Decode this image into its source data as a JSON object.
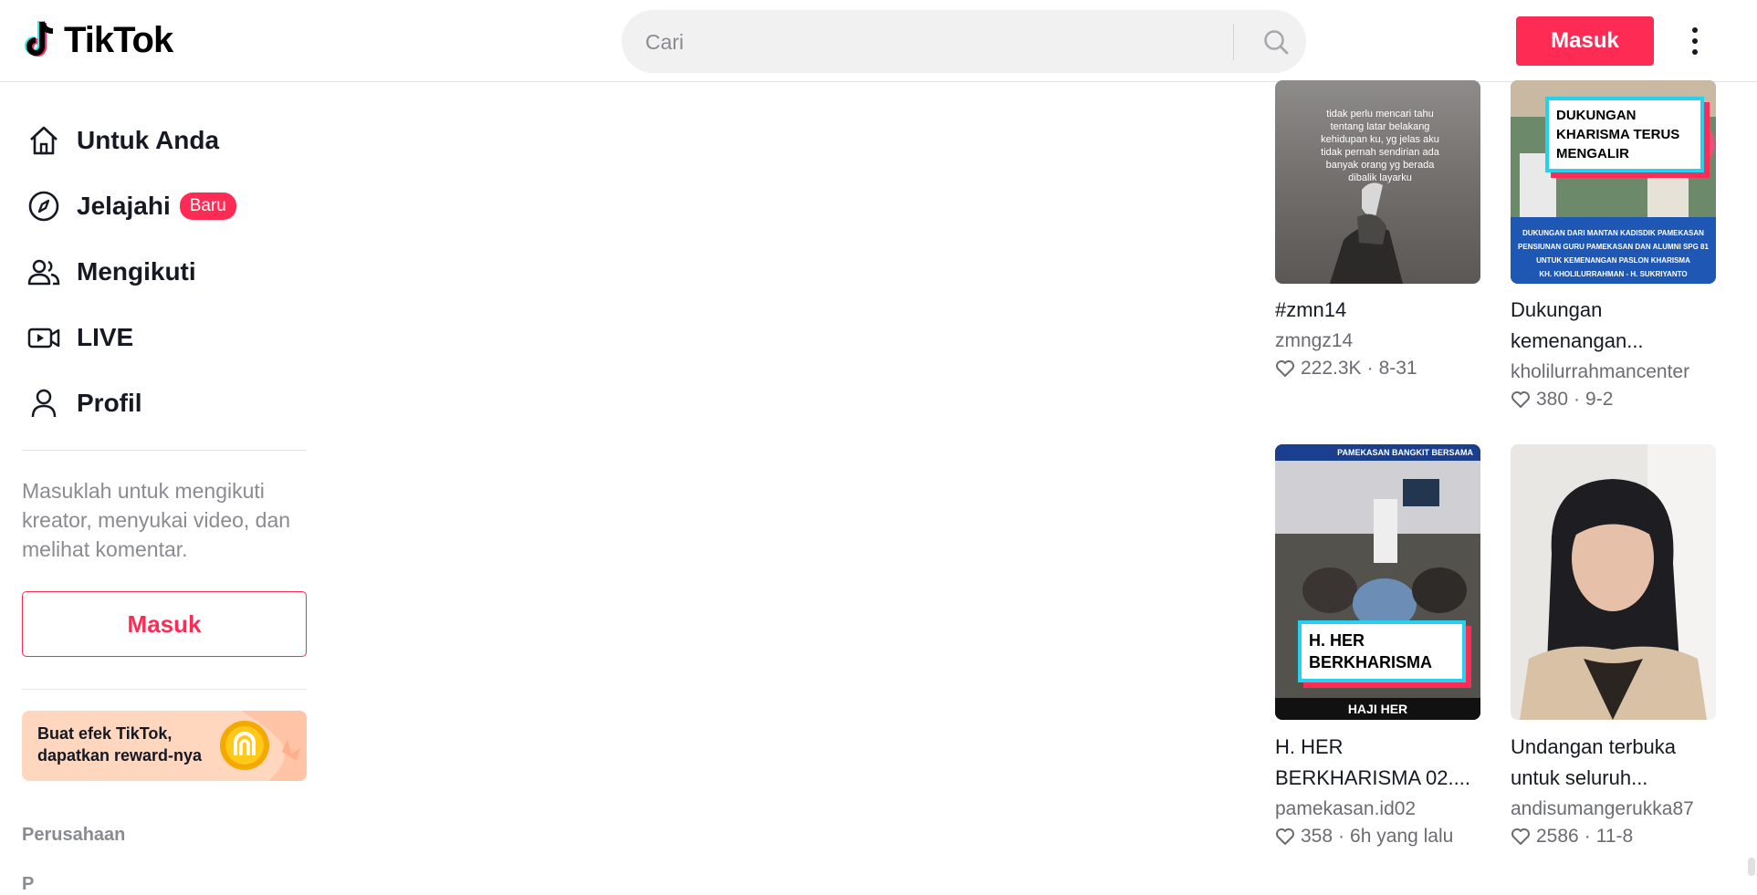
{
  "header": {
    "logo_text": "TikTok",
    "search_placeholder": "Cari",
    "login_label": "Masuk"
  },
  "sidebar": {
    "nav": [
      {
        "label": "Untuk Anda",
        "icon": "home-icon"
      },
      {
        "label": "Jelajahi",
        "icon": "compass-icon",
        "badge": "Baru"
      },
      {
        "label": "Mengikuti",
        "icon": "users-icon"
      },
      {
        "label": "LIVE",
        "icon": "live-icon"
      },
      {
        "label": "Profil",
        "icon": "profile-icon"
      }
    ],
    "login_hint": "Masuklah untuk mengikuti kreator, menyukai video, dan melihat komentar.",
    "login_label": "Masuk",
    "promo": {
      "line1": "Buat efek TikTok,",
      "line2": "dapatkan reward-nya"
    },
    "section_title": "Perusahaan",
    "cut_link": "P"
  },
  "videos": [
    {
      "title": "#zmn14",
      "author": "zmngz14",
      "likes": "222.3K",
      "date": "8-31",
      "thumb_text": "tidak perlu mencari tahu tentang latar belakang kehidupan ku, yg jelas aku tidak pernah sendirian ada banyak orang yg berada dibalik layarku"
    },
    {
      "title": "Dukungan kemenangan...",
      "author": "kholilurrahmancenter",
      "likes": "380",
      "date": "9-2",
      "thumb_overlay": "DUKUNGAN KHARISMA TERUS MENGALIR",
      "thumb_caption": [
        "DUKUNGAN DARI MANTAN KADISDIK PAMEKASAN",
        "PENSIUNAN GURU PAMEKASAN DAN ALUMNI SPG 81",
        "UNTUK KEMENANGAN PASLON KHARISMA",
        "KH. KHOLILURRAHMAN - H. SUKRIYANTO"
      ]
    },
    {
      "title": "H. HER BERKHARISMA 02....",
      "author": "pamekasan.id02",
      "likes": "358",
      "date": "6h yang lalu",
      "thumb_banner": "PAMEKASAN BANGKIT BERSAMA",
      "thumb_overlay": "H. HER BERKHARISMA",
      "thumb_footer": "HAJI HER"
    },
    {
      "title": "Undangan terbuka untuk seluruh...",
      "author": "andisumangerukka87",
      "likes": "2586",
      "date": "11-8"
    }
  ],
  "colors": {
    "accent": "#fe2c55",
    "cyan": "#25d1ee",
    "text": "#161823",
    "muted": "#8a8b91"
  }
}
